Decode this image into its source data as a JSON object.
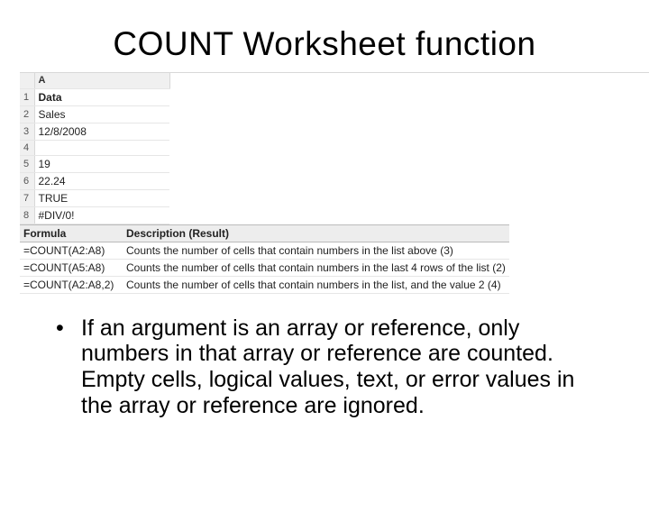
{
  "title": "COUNT Worksheet function",
  "sheet": {
    "col_label": "A",
    "rows": [
      {
        "num": "1",
        "val": "Data",
        "bold": true
      },
      {
        "num": "2",
        "val": "Sales"
      },
      {
        "num": "3",
        "val": "12/8/2008"
      },
      {
        "num": "4",
        "val": ""
      },
      {
        "num": "5",
        "val": "19"
      },
      {
        "num": "6",
        "val": "22.24"
      },
      {
        "num": "7",
        "val": "TRUE"
      },
      {
        "num": "8",
        "val": "#DIV/0!"
      }
    ],
    "formula_header": "Formula",
    "desc_header": "Description (Result)",
    "examples": [
      {
        "formula": "=COUNT(A2:A8)",
        "desc": "Counts the number of cells that contain numbers in the list above (3)"
      },
      {
        "formula": "=COUNT(A5:A8)",
        "desc": "Counts the number of cells that contain numbers in the last 4 rows of the list (2)"
      },
      {
        "formula": "=COUNT(A2:A8,2)",
        "desc": "Counts the number of cells that contain numbers in the list, and the value 2 (4)"
      }
    ]
  },
  "bullet": "If an argument is an array or reference, only numbers in that array or reference are counted. Empty cells, logical values, text, or error values in the array or reference are ignored."
}
